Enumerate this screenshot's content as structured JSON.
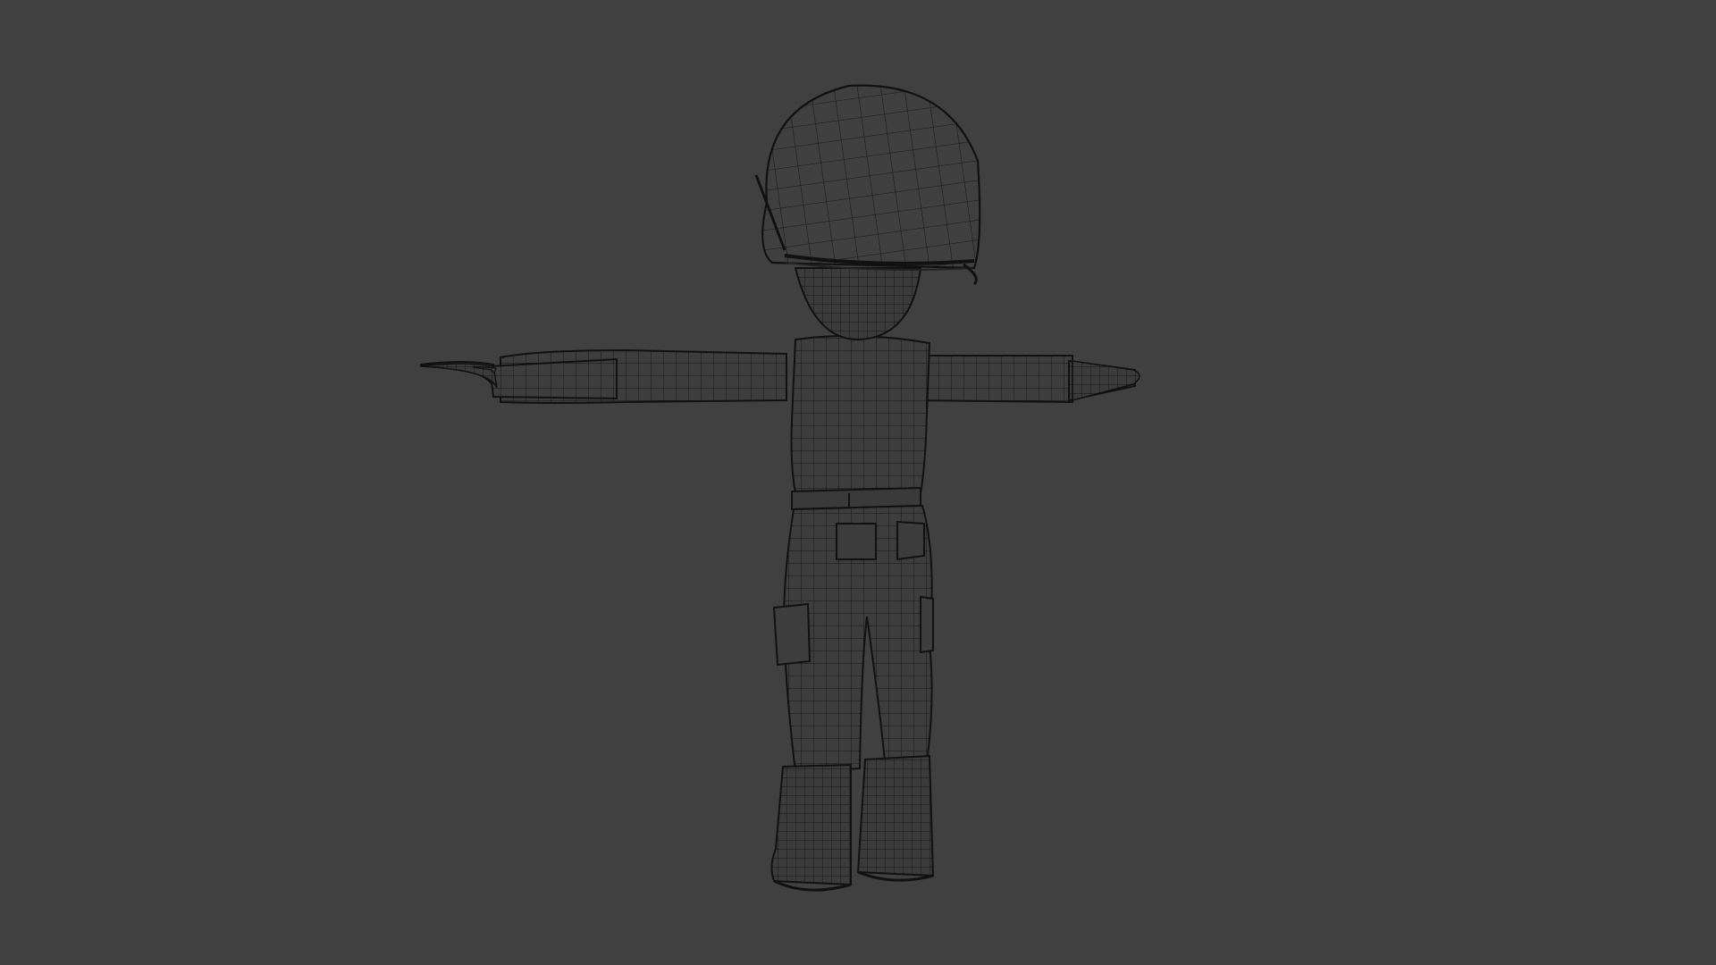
{
  "viewport": {
    "background": "#404040",
    "display_mode": "wireframe",
    "wire_color": "#1a1a1a",
    "solid_color": "#3a3a3a"
  },
  "model": {
    "subject": "character-mesh",
    "pose": "t-pose",
    "view": "rear-three-quarter",
    "parts": [
      "helmet",
      "head",
      "torso",
      "arms",
      "hands",
      "belt",
      "pants",
      "thigh-pocket",
      "boots"
    ]
  }
}
